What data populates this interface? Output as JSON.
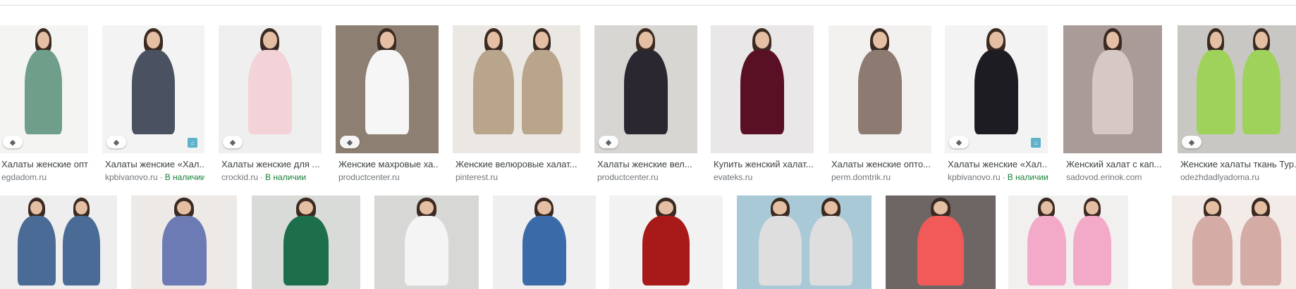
{
  "results_row1": [
    {
      "title": "Халаты женские опто...",
      "source": "egdadom.ru",
      "stock": "",
      "tag": true,
      "badge": false,
      "bg": "#f4f4f2",
      "robe": "#6f9e8a"
    },
    {
      "title": "Халаты женские «Хал...",
      "source": "kpbivanovo.ru",
      "stock": "В наличии",
      "tag": true,
      "badge": true,
      "bg": "#f3f3f3",
      "robe": "#4a5160"
    },
    {
      "title": "Халаты женские для ...",
      "source": "crockid.ru",
      "stock": "В наличии",
      "tag": true,
      "badge": false,
      "bg": "#efefef",
      "robe": "#f3d2d8"
    },
    {
      "title": "Женские махровые ха...",
      "source": "productcenter.ru",
      "stock": "",
      "tag": true,
      "badge": false,
      "bg": "#8e7f73",
      "robe": "#f6f6f6"
    },
    {
      "title": "Женские велюровые халат...",
      "source": "pinterest.ru",
      "stock": "",
      "tag": false,
      "badge": false,
      "bg": "#ebe8e4",
      "robe": "#b9a48c"
    },
    {
      "title": "Халаты женские вел...",
      "source": "productcenter.ru",
      "stock": "",
      "tag": true,
      "badge": false,
      "bg": "#d8d6d2",
      "robe": "#2a2731"
    },
    {
      "title": "Купить женский халат...",
      "source": "evateks.ru",
      "stock": "",
      "tag": false,
      "badge": false,
      "bg": "#e9e7e7",
      "robe": "#5a1024"
    },
    {
      "title": "Халаты женские опто...",
      "source": "perm.domtrik.ru",
      "stock": "",
      "tag": false,
      "badge": false,
      "bg": "#f2f1ef",
      "robe": "#8d7a70"
    },
    {
      "title": "Халаты женские «Хал...",
      "source": "kpbivanovo.ru",
      "stock": "В наличии",
      "tag": true,
      "badge": true,
      "bg": "#f3f3f3",
      "robe": "#1c1c22"
    },
    {
      "title": "Женский халат с кап...",
      "source": "sadovod.erinok.com",
      "stock": "",
      "tag": false,
      "badge": false,
      "bg": "#a99c98",
      "robe": "#d6c8c4"
    },
    {
      "title": "Женские халаты ткань Тур...",
      "source": "odezhdadlyadoma.ru",
      "stock": "",
      "tag": true,
      "badge": false,
      "bg": "#c9c7c3",
      "robe": "#9ed25a"
    }
  ],
  "results_row2": [
    {
      "bg": "#eeeeee",
      "robe": "#4a6b96"
    },
    {
      "bg": "#ece9e6",
      "robe": "#6d7bb4"
    },
    {
      "bg": "#d9dbd9",
      "robe": "#1d6f4b"
    },
    {
      "bg": "#d7d7d5",
      "robe": "#f4f4f4"
    },
    {
      "bg": "#efefef",
      "robe": "#3b6aa8"
    },
    {
      "bg": "#f2f2f2",
      "robe": "#a81a1a"
    },
    {
      "bg": "#a9c9d6",
      "robe": "#dedede"
    },
    {
      "bg": "#6e6665",
      "robe": "#f25a5a"
    },
    {
      "bg": "#f1f0ef",
      "robe": "#f3a9c8"
    },
    {
      "bg": "#f2ebe7",
      "robe": "#d4aba5"
    }
  ],
  "icons": {
    "tag": "tag-icon",
    "badge": "brand-badge-icon"
  },
  "colors": {
    "stock": "#188038",
    "source": "#70757a",
    "title": "#3c4043"
  }
}
